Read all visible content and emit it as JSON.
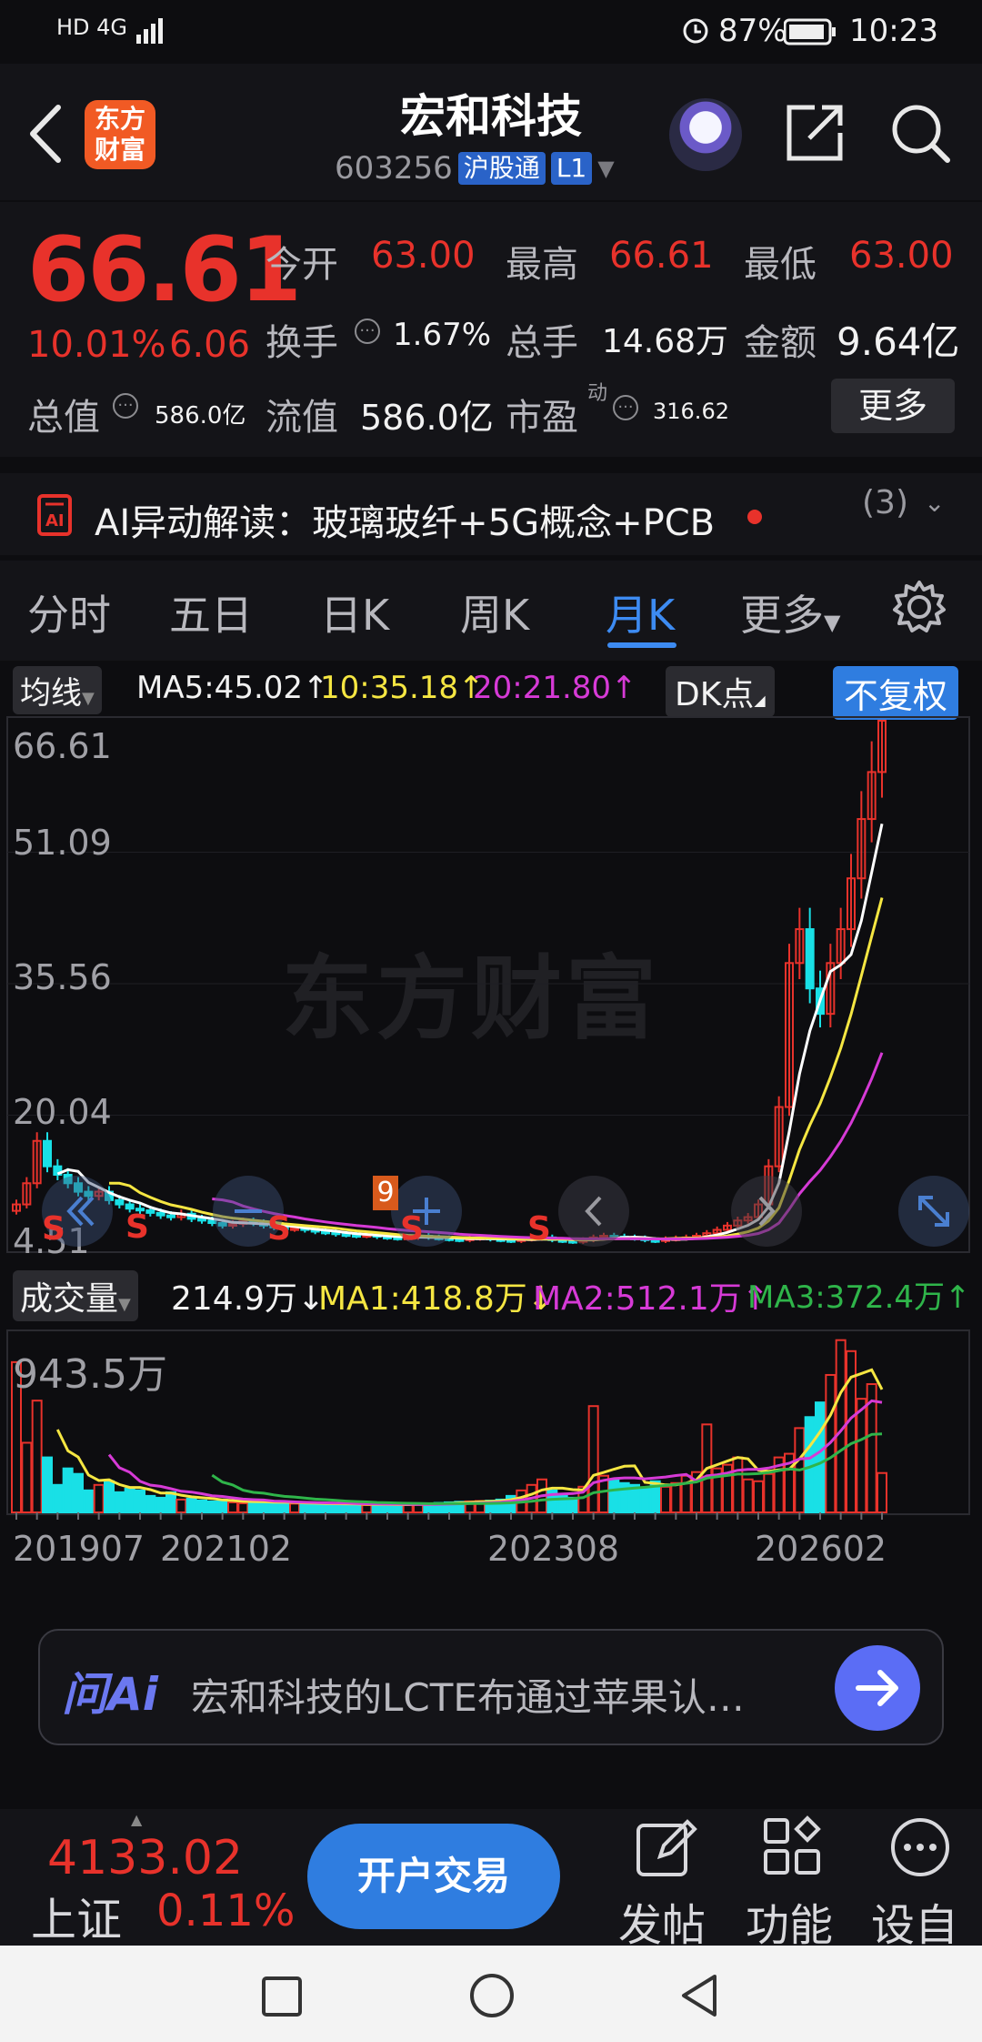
{
  "status_bar": {
    "network": "HD 4G",
    "battery": "87%",
    "time": "10:23"
  },
  "header": {
    "title": "宏和科技",
    "code": "603256",
    "tag1": "沪股通",
    "tag2": "L1",
    "logo_text": "东方财富"
  },
  "quote": {
    "price": "66.61",
    "change_pct": "10.01%",
    "change": "6.06",
    "open_label": "今开",
    "open": "63.00",
    "high_label": "最高",
    "high": "66.61",
    "low_label": "最低",
    "low": "63.00",
    "turnover_label": "换手",
    "turnover": "1.67%",
    "volume_label": "总手",
    "volume": "14.68万",
    "amount_label": "金额",
    "amount": "9.64亿",
    "mktcap_label": "总值",
    "mktcap": "586.0亿",
    "float_label": "流值",
    "float": "586.0亿",
    "pe_label": "市盈",
    "pe_sup": "动",
    "pe": "316.62",
    "more_label": "更多"
  },
  "ai_row": {
    "text": "AI异动解读：玻璃玻纤+5G概念+PCB",
    "count": "(3)"
  },
  "tabs": [
    "分时",
    "五日",
    "日K",
    "周K",
    "月K",
    "更多"
  ],
  "chart": {
    "ma_selector": "均线",
    "ma5": "MA5:45.02↑",
    "ma10": "10:35.18↑",
    "ma20": "20:21.80↑",
    "dk_label": "DK点",
    "fq_label": "不复权",
    "price_ticks": [
      "66.61",
      "51.09",
      "35.56",
      "20.04",
      "4.51"
    ],
    "vol_selector": "成交量",
    "vol_value": "214.9万↓",
    "vol_ma1": "MA1:418.8万↓",
    "vol_ma2": "MA2:512.1万↑",
    "vol_ma3": "MA3:372.4万↑",
    "vol_max": "943.5万",
    "dates": [
      "201907",
      "202102",
      "202308",
      "202602"
    ],
    "watermark": "东方财富",
    "marker_s": "S",
    "marker_b9": "9",
    "colors": {
      "up": "#e8322b",
      "down": "#19e0e6",
      "ma5": "#ffffff",
      "ma10": "#f5e642",
      "ma20": "#d63ad6",
      "vma3": "#2fb54a"
    }
  },
  "chart_data": {
    "type": "candlestick",
    "period": "monthly",
    "x_start": "201907",
    "x_end": "202602",
    "ylim": [
      4.51,
      66.61
    ],
    "closes": [
      9.5,
      12,
      17,
      14,
      13,
      12,
      11,
      10.5,
      11,
      10,
      9.5,
      9,
      8.8,
      8.5,
      8.2,
      8,
      8.4,
      7.8,
      7.6,
      7.3,
      7,
      7.2,
      7.5,
      7.3,
      7,
      6.8,
      6.6,
      6.7,
      6.5,
      6.3,
      6.2,
      6,
      5.9,
      5.8,
      5.9,
      5.7,
      5.6,
      5.5,
      5.6,
      5.8,
      5.6,
      5.5,
      5.4,
      5.3,
      5.5,
      5.6,
      5.4,
      5.3,
      5.2,
      5.4,
      5.5,
      5.6,
      5.3,
      5.2,
      5.1,
      5.3,
      5.6,
      5.8,
      5.7,
      5.6,
      5.5,
      5.3,
      5.2,
      5.4,
      5.5,
      5.6,
      5.8,
      6.1,
      6.5,
      7,
      7.6,
      8,
      9.5,
      14,
      21,
      38,
      42,
      35,
      32,
      38,
      42,
      48,
      55,
      60.55,
      66.61
    ],
    "volume_max": "943.5万",
    "volumes": [
      820,
      380,
      610,
      300,
      150,
      240,
      210,
      120,
      150,
      170,
      110,
      130,
      120,
      90,
      80,
      110,
      70,
      75,
      65,
      60,
      70,
      55,
      50,
      60,
      58,
      55,
      52,
      48,
      45,
      50,
      48,
      46,
      44,
      42,
      40,
      46,
      44,
      40,
      42,
      45,
      48,
      52,
      55,
      58,
      60,
      62,
      64,
      70,
      90,
      120,
      150,
      180,
      120,
      90,
      80,
      140,
      580,
      200,
      180,
      160,
      150,
      130,
      170,
      140,
      160,
      200,
      220,
      480,
      240,
      260,
      300,
      180,
      170,
      210,
      300,
      320,
      460,
      520,
      600,
      750,
      940,
      880,
      620,
      700,
      214.9
    ]
  },
  "ask": {
    "logo": "问Ai",
    "text": "宏和科技的LCTE布通过苹果认…"
  },
  "bottom": {
    "index_value": "4133.02",
    "index_name": "上证",
    "index_change": "0.11%",
    "open_account": "开户交易",
    "post": "发帖",
    "functions": "功能",
    "settings": "设自"
  }
}
